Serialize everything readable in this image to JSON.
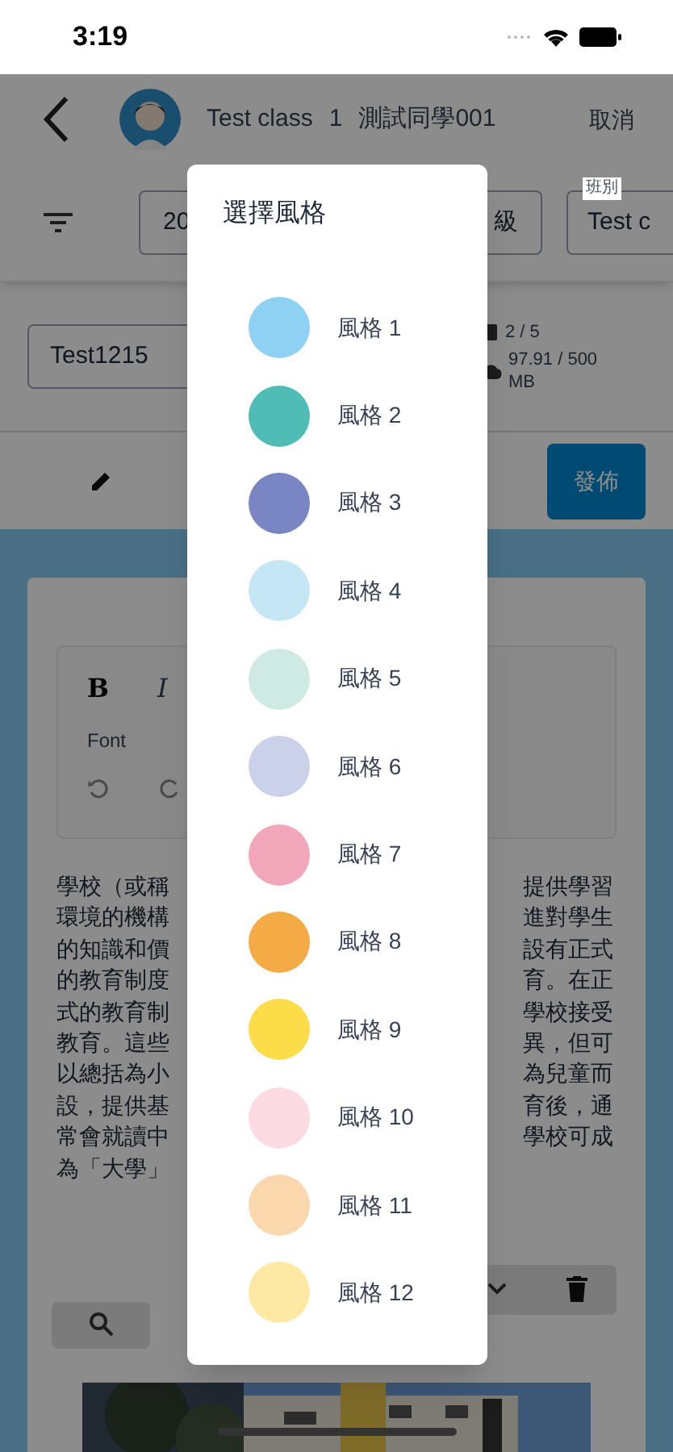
{
  "status_bar": {
    "time": "3:19"
  },
  "header": {
    "class_name": "Test class",
    "seat": "1",
    "student": "測試同學001",
    "cancel": "取消"
  },
  "filters": [
    {
      "value": "20"
    },
    {
      "value": "級"
    },
    {
      "label": "班別",
      "value": "Test c"
    }
  ],
  "name_field": {
    "value": "Test1215"
  },
  "usage": {
    "images": "2 / 5",
    "storage": "97.91 / 500 MB"
  },
  "publish_button": "發佈",
  "editor": {
    "bold": "B",
    "italic": "I",
    "font_label": "Font",
    "paragraph_left": [
      "學校（或稱",
      "環境的機構",
      "的知識和價",
      "的教育制度",
      "式的教育制",
      "教育。這些",
      "以總括為小",
      "設，提供基",
      "常會就讀中",
      "為「大學」"
    ],
    "paragraph_right": [
      "提供學習",
      "進對學生",
      "設有正式",
      "育。在正",
      "學校接受",
      "異，但可",
      "為兒童而",
      "育後，通",
      "學校可成"
    ]
  },
  "dialog": {
    "title": "選擇風格",
    "styles": [
      {
        "label": "風格 1",
        "color": "#8fd1f2"
      },
      {
        "label": "風格 2",
        "color": "#4fbcb6"
      },
      {
        "label": "風格 3",
        "color": "#7a85c3"
      },
      {
        "label": "風格 4",
        "color": "#c5e6f5"
      },
      {
        "label": "風格 5",
        "color": "#cfe9e3"
      },
      {
        "label": "風格 6",
        "color": "#ccd1ea"
      },
      {
        "label": "風格 7",
        "color": "#f1a7b9"
      },
      {
        "label": "風格 8",
        "color": "#f4aa45"
      },
      {
        "label": "風格 9",
        "color": "#fddc49"
      },
      {
        "label": "風格 10",
        "color": "#fcdbe3"
      },
      {
        "label": "風格 11",
        "color": "#fbd7ad"
      },
      {
        "label": "風格 12",
        "color": "#fde9a3"
      }
    ]
  }
}
